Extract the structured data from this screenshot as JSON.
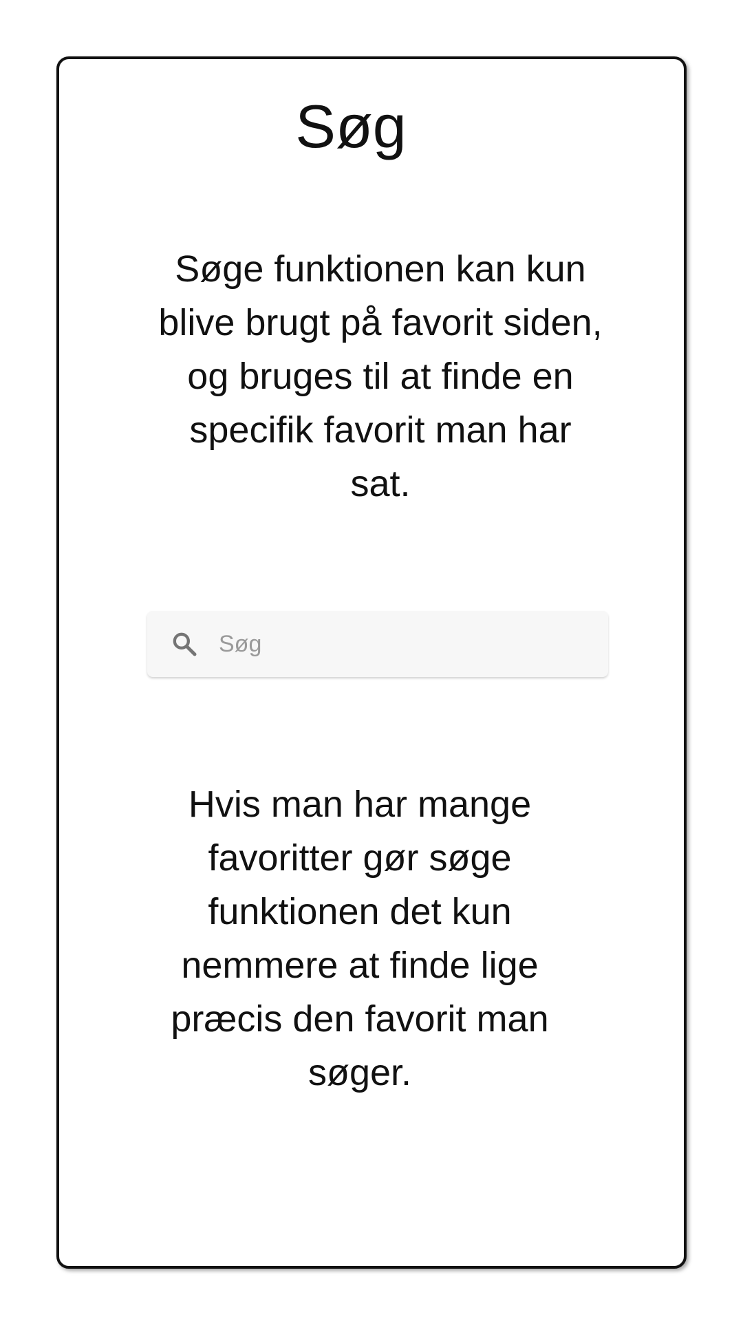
{
  "page": {
    "title": "Søg",
    "description_1": "Søge funktionen kan kun blive brugt på favorit siden, og bruges til at finde en specifik favorit man har sat.",
    "description_2": "Hvis man har mange favoritter gør søge funktionen det kun nemmere at finde lige præcis den favorit man søger."
  },
  "search": {
    "placeholder": "Søg",
    "value": "",
    "icon": "search-icon"
  },
  "colors": {
    "text": "#111111",
    "border": "#111111",
    "search_background": "#f7f7f7",
    "placeholder": "#9a9a9a",
    "icon": "#757575"
  }
}
